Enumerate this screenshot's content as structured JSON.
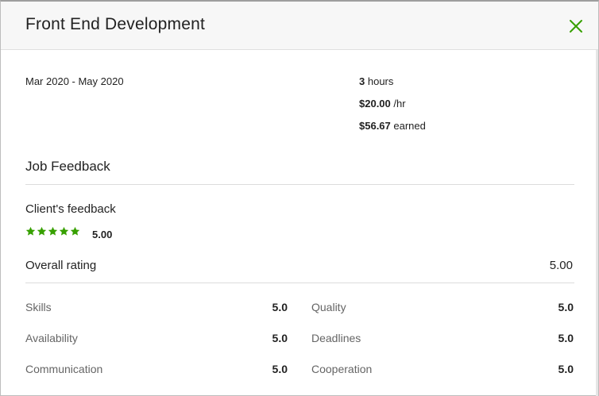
{
  "header": {
    "title": "Front End Development",
    "close_icon": "close-icon"
  },
  "colors": {
    "accent": "#37a000",
    "header_bg": "#f7f7f7"
  },
  "contract": {
    "dates": "Mar 2020 - May 2020",
    "hours_value": "3",
    "hours_unit": "hours",
    "rate_value": "$20.00",
    "rate_unit": "/hr",
    "earned_value": "$56.67",
    "earned_unit": "earned"
  },
  "feedback": {
    "section_title": "Job Feedback",
    "client_label": "Client's feedback",
    "stars_count": 5,
    "stars_score": "5.00",
    "overall_label": "Overall rating",
    "overall_value": "5.00",
    "criteria": [
      {
        "label": "Skills",
        "value": "5.0"
      },
      {
        "label": "Quality",
        "value": "5.0"
      },
      {
        "label": "Availability",
        "value": "5.0"
      },
      {
        "label": "Deadlines",
        "value": "5.0"
      },
      {
        "label": "Communication",
        "value": "5.0"
      },
      {
        "label": "Cooperation",
        "value": "5.0"
      }
    ]
  }
}
